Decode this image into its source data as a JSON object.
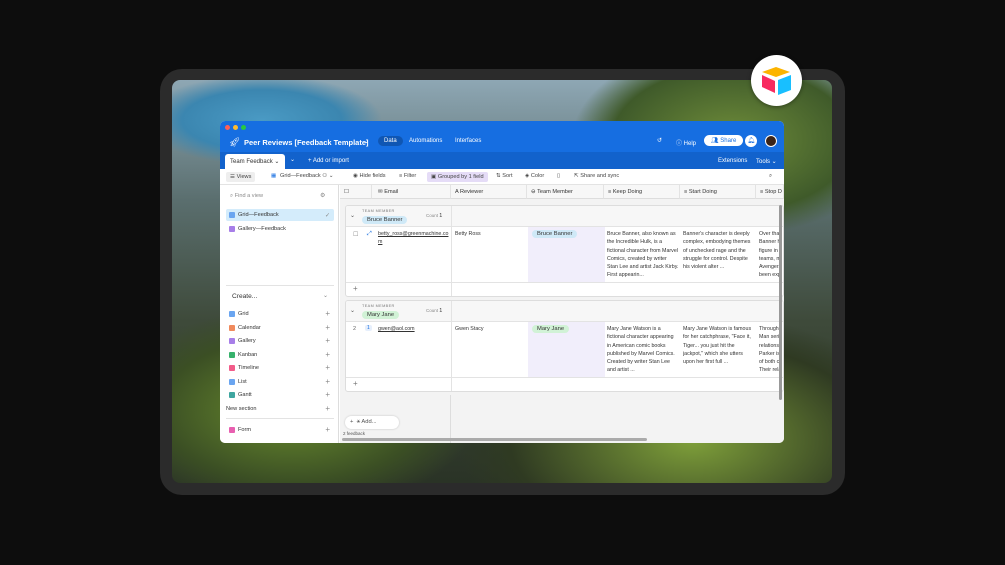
{
  "app": {
    "title": "Peer Reviews [Feedback Template]",
    "nav": [
      "Data",
      "Automations",
      "Interfaces"
    ],
    "help": "Help",
    "share": "Share"
  },
  "tabs": {
    "active": "Team Feedback",
    "add": "Add or import",
    "extensions": "Extensions",
    "tools": "Tools"
  },
  "toolbar": {
    "views": "Views",
    "view_name": "Grid—Feedback",
    "hide": "Hide fields",
    "filter": "Filter",
    "grouped": "Grouped by 1 field",
    "sort": "Sort",
    "color": "Color",
    "share_sync": "Share and sync"
  },
  "sidebar": {
    "find_placeholder": "Find a view",
    "views": [
      "Grid—Feedback",
      "Gallery—Feedback"
    ],
    "create": "Create...",
    "create_items": [
      "Grid",
      "Calendar",
      "Gallery",
      "Kanban",
      "Timeline",
      "List",
      "Gantt"
    ],
    "new_section": "New section",
    "form": "Form"
  },
  "columns": [
    "Email",
    "Reviewer",
    "Team Member",
    "Keep Doing",
    "Start Doing",
    "Stop D"
  ],
  "groups": [
    {
      "label": "TEAM MEMBER",
      "name": "Bruce Banner",
      "count_label": "Count",
      "count": "1",
      "color": "#cfe9f7",
      "row": {
        "num": "",
        "email": "betty_ross@greenmachine.com",
        "reviewer": "Betty Ross",
        "member": "Bruce Banner",
        "keep": "Bruce Banner, also known as the Incredible Hulk, is a fictional character from Marvel Comics, created by writer Stan Lee and artist Jack Kirby. First appearin...",
        "start": "Banner's character is deeply complex, embodying themes of unchecked rage and the struggle for control. Despite his violent alter ...",
        "stop": "Over tha Banner h figure in teams, m Avengers been exp"
      }
    },
    {
      "label": "TEAM MEMBER",
      "name": "Mary Jane",
      "count_label": "Count",
      "count": "1",
      "color": "#d1f2d6",
      "row": {
        "num": "2",
        "email": "gwen@aol.com",
        "reviewer": "Gwen Stacy",
        "member": "Mary Jane",
        "keep": "Mary Jane Watson is a fictional character appearing in American comic books published by Marvel Comics. Created by writer Stan Lee and artist ...",
        "start": "Mary Jane Watson is famous for her catchphrase, \"Face it, Tiger... you just hit the jackpot,\" which she utters upon her first full ...",
        "stop": "Througho Man seri relations Parker is of both c Their rela"
      }
    }
  ],
  "footer": {
    "add": "Add...",
    "count": "2 feedback"
  }
}
